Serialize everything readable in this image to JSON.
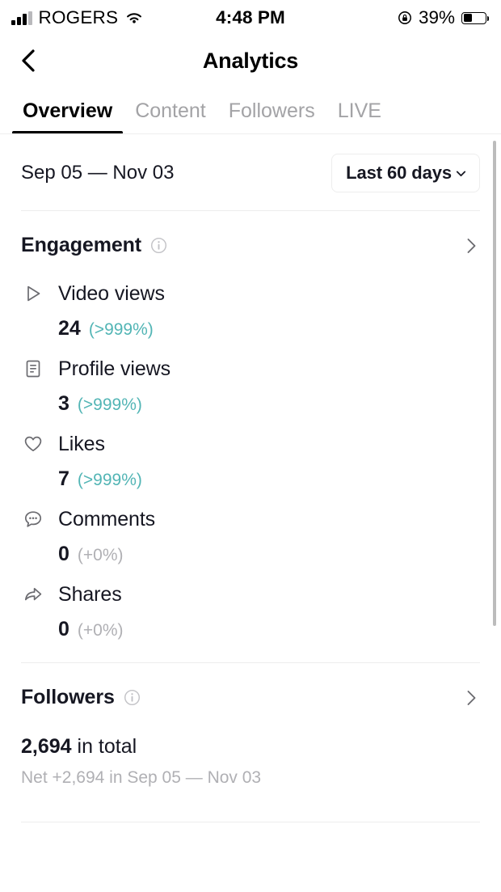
{
  "status_bar": {
    "carrier": "ROGERS",
    "time": "4:48 PM",
    "battery_percent": "39%",
    "battery_level": 39,
    "signal_icon": "signal-bars-icon",
    "wifi_icon": "wifi-icon",
    "lock_icon": "rotation-lock-icon",
    "battery_icon": "battery-icon"
  },
  "nav": {
    "back_icon": "chevron-left-icon",
    "title": "Analytics"
  },
  "tabs": [
    {
      "label": "Overview",
      "active": true
    },
    {
      "label": "Content",
      "active": false
    },
    {
      "label": "Followers",
      "active": false
    },
    {
      "label": "LIVE",
      "active": false
    }
  ],
  "date_filter": {
    "range_label": "Sep 05 — Nov 03",
    "selector_label": "Last 60 days",
    "selector_chevron_icon": "chevron-down-icon"
  },
  "engagement": {
    "title": "Engagement",
    "info_icon": "info-circle-icon",
    "chevron_icon": "chevron-right-icon",
    "metrics": [
      {
        "icon": "play-triangle-icon",
        "label": "Video views",
        "value": "24",
        "delta": "(>999%)",
        "delta_trend": "up"
      },
      {
        "icon": "document-lines-icon",
        "label": "Profile views",
        "value": "3",
        "delta": "(>999%)",
        "delta_trend": "up"
      },
      {
        "icon": "heart-icon",
        "label": "Likes",
        "value": "7",
        "delta": "(>999%)",
        "delta_trend": "up"
      },
      {
        "icon": "comment-bubble-icon",
        "label": "Comments",
        "value": "0",
        "delta": "(+0%)",
        "delta_trend": "flat"
      },
      {
        "icon": "share-arrow-icon",
        "label": "Shares",
        "value": "0",
        "delta": "(+0%)",
        "delta_trend": "flat"
      }
    ]
  },
  "followers": {
    "title": "Followers",
    "info_icon": "info-circle-icon",
    "chevron_icon": "chevron-right-icon",
    "total_count": "2,694",
    "total_suffix": " in total",
    "net_change": "Net +2,694 in Sep 05 — Nov 03"
  },
  "colors": {
    "accent_teal": "#52b5b5",
    "text_primary": "#161722",
    "text_muted": "#b0b0b4",
    "tab_inactive": "#a3a3a6",
    "divider": "#ededed"
  }
}
